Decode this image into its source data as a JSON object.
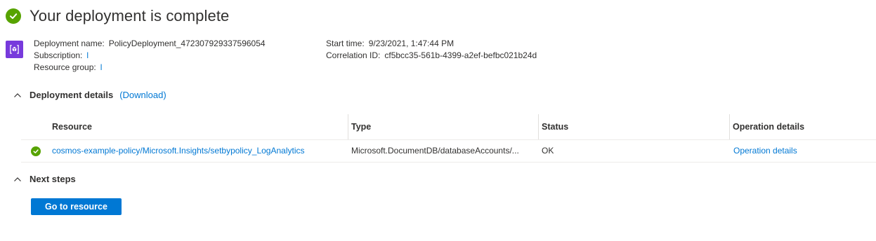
{
  "header": {
    "title": "Your deployment is complete",
    "status_icon": "success-check-icon",
    "status_color": "#57a300"
  },
  "deployment": {
    "icon": "deployment-cube-icon",
    "icon_color": "#773adc",
    "name_label": "Deployment name:",
    "name_value": "PolicyDeployment_472307929337596054",
    "subscription_label": "Subscription:",
    "subscription_value": "l",
    "resource_group_label": "Resource group:",
    "resource_group_value": "l",
    "start_time_label": "Start time:",
    "start_time_value": "9/23/2021, 1:47:44 PM",
    "correlation_label": "Correlation ID:",
    "correlation_value": "cf5bcc35-561b-4399-a2ef-befbc021b24d"
  },
  "deployment_details": {
    "label": "Deployment details",
    "download_link": "(Download)",
    "columns": [
      "Resource",
      "Type",
      "Status",
      "Operation details"
    ],
    "rows": [
      {
        "resource": "cosmos-example-policy/Microsoft.Insights/setbypolicy_LogAnalytics",
        "type": "Microsoft.DocumentDB/databaseAccounts/...",
        "status": "OK",
        "operation_details": "Operation details"
      }
    ]
  },
  "next_steps": {
    "label": "Next steps",
    "button_label": "Go to resource"
  },
  "colors": {
    "accent": "#0078d4",
    "success": "#57a300",
    "text": "#323130"
  }
}
